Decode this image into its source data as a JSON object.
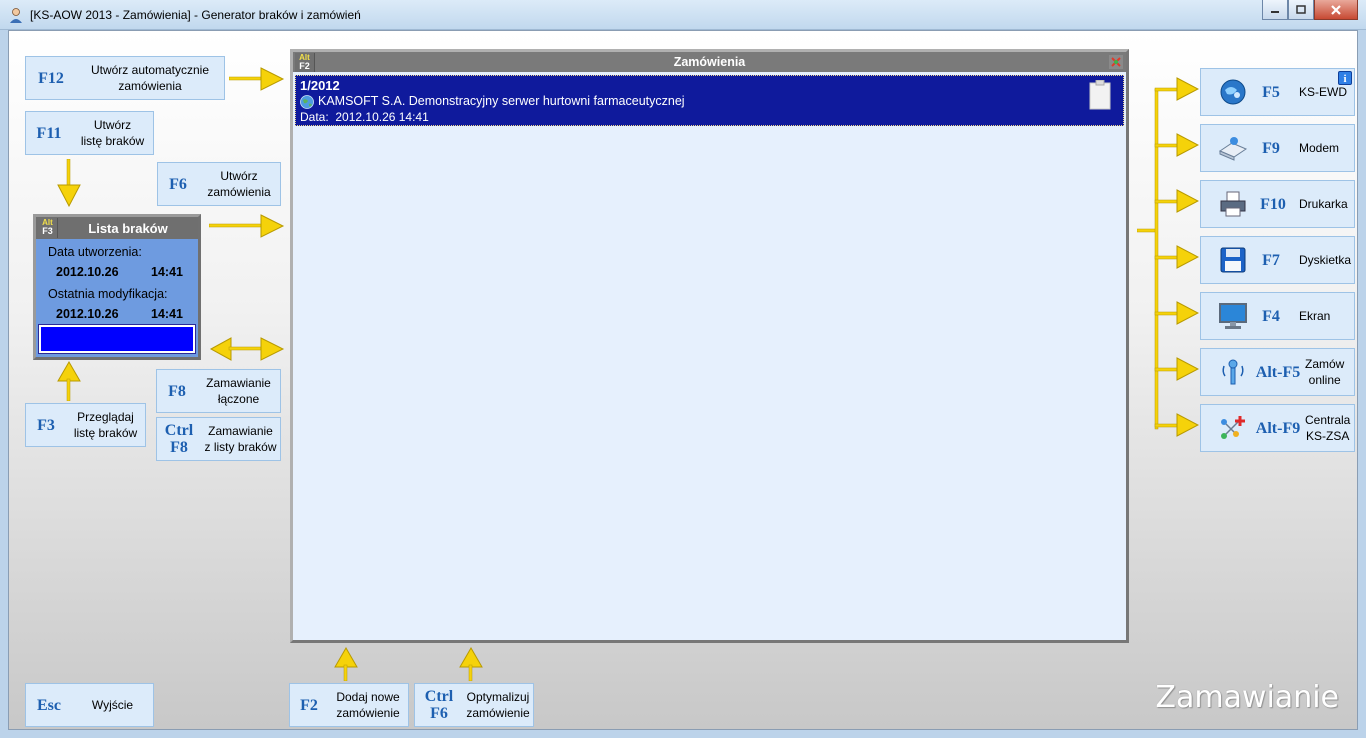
{
  "window": {
    "title": "[KS-AOW 2013 - Zamówienia] - Generator braków i zamówień"
  },
  "left": {
    "f12": {
      "key": "F12",
      "label1": "Utwórz automatycznie",
      "label2": "zamówienia"
    },
    "f11": {
      "key": "F11",
      "label1": "Utwórz",
      "label2": "listę braków"
    },
    "f6": {
      "key": "F6",
      "label1": "Utwórz",
      "label2": "zamówienia"
    },
    "f8": {
      "key": "F8",
      "label1": "Zamawianie",
      "label2": "łączone"
    },
    "ctrlf8": {
      "key1": "Ctrl",
      "key2": "F8",
      "label1": "Zamawianie",
      "label2": "z listy braków"
    },
    "f3": {
      "key": "F3",
      "label1": "Przeglądaj",
      "label2": "listę braków"
    },
    "esc": {
      "key": "Esc",
      "label": "Wyjście"
    }
  },
  "lista": {
    "alt": "Alt",
    "key": "F3",
    "title": "Lista braków",
    "created_label": "Data utworzenia:",
    "created_date": "2012.10.26",
    "created_time": "14:41",
    "modified_label": "Ostatnia modyfikacja:",
    "modified_date": "2012.10.26",
    "modified_time": "14:41"
  },
  "panel": {
    "alt": "Alt",
    "key": "F2",
    "title": "Zamówienia",
    "orders": [
      {
        "number": "1/2012",
        "supplier": "KAMSOFT S.A. Demonstracyjny serwer hurtowni farmaceutycznej",
        "date_label": "Data:",
        "date": "2012.10.26 14:41"
      }
    ]
  },
  "bottom": {
    "f2": {
      "key": "F2",
      "label1": "Dodaj nowe",
      "label2": "zamówienie"
    },
    "ctrlf6": {
      "key1": "Ctrl",
      "key2": "F6",
      "label1": "Optymalizuj",
      "label2": "zamówienie"
    }
  },
  "right": [
    {
      "key": "F5",
      "label": "KS-EWD",
      "icon": "ks-ewd-icon"
    },
    {
      "key": "F9",
      "label": "Modem",
      "icon": "modem-icon"
    },
    {
      "key": "F10",
      "label": "Drukarka",
      "icon": "printer-icon"
    },
    {
      "key": "F7",
      "label": "Dyskietka",
      "icon": "floppy-icon"
    },
    {
      "key": "F4",
      "label": "Ekran",
      "icon": "monitor-icon"
    },
    {
      "key": "Alt-F5",
      "label1": "Zamów",
      "label2": "online",
      "icon": "online-order-icon"
    },
    {
      "key": "Alt-F9",
      "label1": "Centrala",
      "label2": "KS-ZSA",
      "icon": "central-icon"
    }
  ],
  "info_badge": "i",
  "watermark": "Zamawianie",
  "colors": {
    "fkey": "#1d5fb0",
    "tile_bg": "#dcebfa",
    "order_bg": "#0f1a9c",
    "lista_bg": "#6e9be0",
    "lista_bar": "#0000ff",
    "arrow": "#f5d20a"
  }
}
